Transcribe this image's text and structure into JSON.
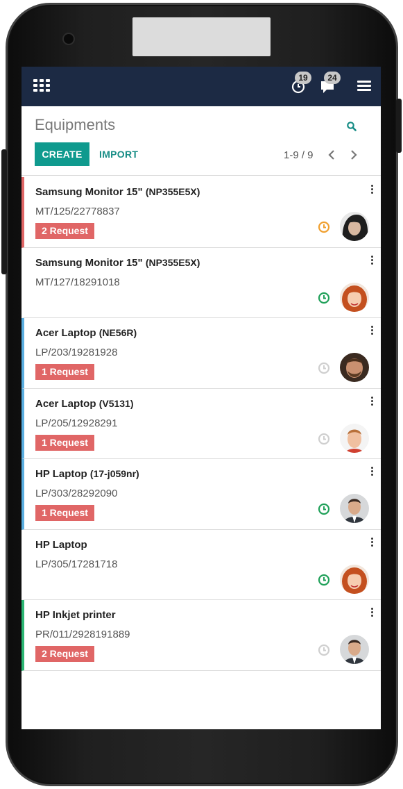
{
  "header": {
    "activity_count": "19",
    "messages_count": "24"
  },
  "control": {
    "title": "Equipments",
    "create_label": "CREATE",
    "import_label": "IMPORT",
    "pager": "1-9 / 9"
  },
  "colors": {
    "topbar": "#1c2a44",
    "primary": "#0f9a8e",
    "badge": "#e06666",
    "clock_orange": "#f0a030",
    "clock_green": "#21a15a",
    "clock_grey": "#cfcfcf"
  },
  "cards": [
    {
      "name": "Samsung Monitor 15\"",
      "model": "(NP355E5X)",
      "serial": "MT/125/22778837",
      "badge": "2 Request",
      "stripe": "#e06666",
      "clock": "orange",
      "avatar": "avatar-woman-dark"
    },
    {
      "name": "Samsung Monitor 15\"",
      "model": "(NP355E5X)",
      "serial": "MT/127/18291018",
      "badge": "",
      "stripe": "",
      "clock": "green",
      "avatar": "avatar-woman-redhead"
    },
    {
      "name": "Acer Laptop",
      "model": "(NE56R)",
      "serial": "LP/203/19281928",
      "badge": "1 Request",
      "stripe": "#5aaee0",
      "clock": "grey",
      "avatar": "avatar-man-beard"
    },
    {
      "name": "Acer Laptop",
      "model": "(V5131)",
      "serial": "LP/205/12928291",
      "badge": "1 Request",
      "stripe": "#5aaee0",
      "clock": "grey",
      "avatar": "avatar-man-young"
    },
    {
      "name": "HP Laptop",
      "model": "(17-j059nr)",
      "serial": "LP/303/28292090",
      "badge": "1 Request",
      "stripe": "#5aaee0",
      "clock": "green",
      "avatar": "avatar-man-suit"
    },
    {
      "name": "HP Laptop",
      "model": "",
      "serial": "LP/305/17281718",
      "badge": "",
      "stripe": "",
      "clock": "green",
      "avatar": "avatar-woman-redhead"
    },
    {
      "name": "HP Inkjet printer",
      "model": "",
      "serial": "PR/011/2928191889",
      "badge": "2 Request",
      "stripe": "#2bb673",
      "clock": "grey",
      "avatar": "avatar-man-suit"
    }
  ]
}
